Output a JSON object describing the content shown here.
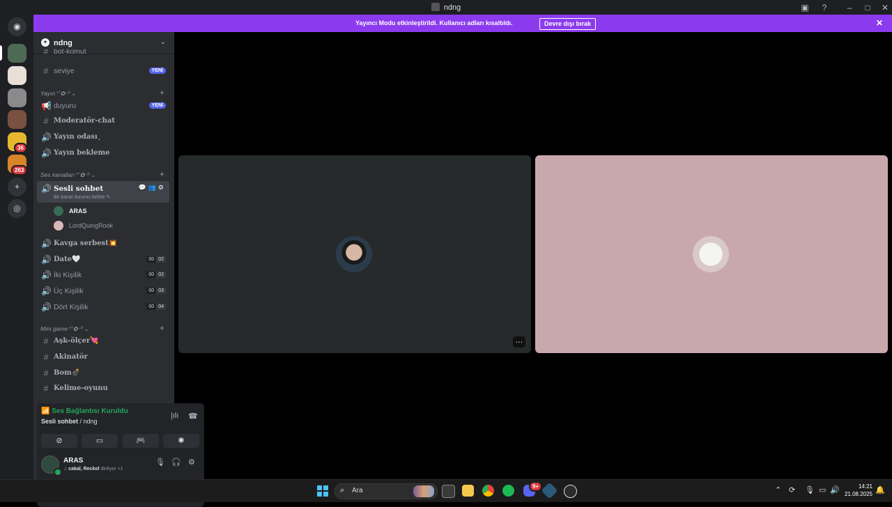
{
  "window": {
    "title": "ndng"
  },
  "banner": {
    "message": "Yayıncı Modu etkinleştirildi. Kullanıcı adları kısaltıldı.",
    "button": "Devre dışı bırak"
  },
  "rail": {
    "badges": [
      "36",
      "263"
    ]
  },
  "server": {
    "name": "ndng"
  },
  "channels_top": [
    {
      "type": "text",
      "label": "bot-komut"
    },
    {
      "type": "text",
      "label": "seviye",
      "badge": "YENİ"
    }
  ],
  "categories": {
    "yayin": "Yayın⁺˚✿‧⁰",
    "ses": "Ses kanalları⁺˚✿‧⁰",
    "mini": "Mini game⁺˚✿‧⁰"
  },
  "channels_yayin": [
    {
      "type": "announce",
      "label": "duyuru",
      "badge": "YENİ"
    },
    {
      "type": "text",
      "label": "Moderatör-chat"
    },
    {
      "type": "voice",
      "label": "Yayın odası¸"
    },
    {
      "type": "voice",
      "label": "Yayın bekleme"
    }
  ],
  "active_channel": {
    "label": "Sesli sohbet",
    "status": "Bir kanal durumu belirle",
    "members": [
      "ARAS",
      "LordQuingRook"
    ]
  },
  "channels_ses": [
    {
      "label": "Kavga serbest💥"
    },
    {
      "label": "Date🤍",
      "count": [
        "00",
        "02"
      ]
    },
    {
      "label": "İki Kişilik",
      "count": [
        "00",
        "02"
      ]
    },
    {
      "label": "Üç Kişilik",
      "count": [
        "00",
        "03"
      ]
    },
    {
      "label": "Dört Kişilik",
      "count": [
        "00",
        "04"
      ]
    }
  ],
  "channels_mini": [
    {
      "label": "Aşk-ölçer💘"
    },
    {
      "label": "Akinatör"
    },
    {
      "label": "Bom💣"
    },
    {
      "label": "Kelime-oyunu"
    }
  ],
  "voice_panel": {
    "status": "Ses Bağlantısı Kuruldu",
    "channel": "Sesli sohbet",
    "server": "ndng"
  },
  "user": {
    "name": "ARAS",
    "activity_names": "cakal, Reckol",
    "activity_suffix": "dinliyor +1"
  },
  "taskbar": {
    "search_placeholder": "Ara",
    "time": "14:21",
    "date": "21.08.2025",
    "discord_badge": "9+"
  },
  "colors": {
    "banner": "#8b3bed",
    "connected": "#23a55a",
    "new_badge": "#5865f2",
    "tile_b": "#c9a8ad"
  }
}
